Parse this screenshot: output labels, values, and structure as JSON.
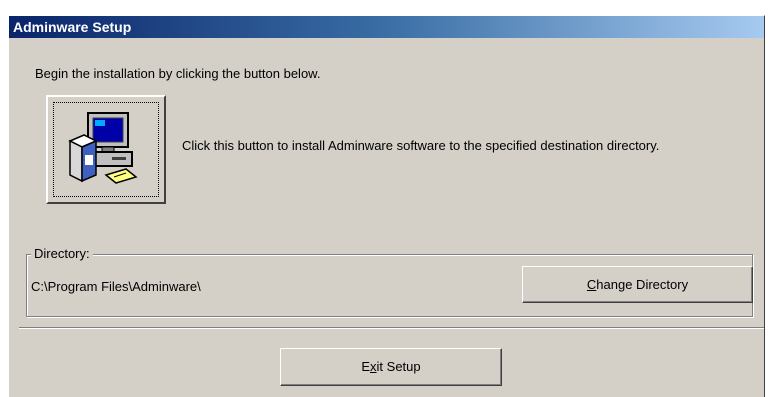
{
  "window": {
    "title": "Adminware Setup"
  },
  "intro_text": "Begin the installation by clicking the button below.",
  "install": {
    "icon": "computer-install-icon",
    "description": "Click this button to install Adminware software to the specified destination directory."
  },
  "directory": {
    "group_label": "Directory:",
    "path": "C:\\Program Files\\Adminware\\",
    "change_button": {
      "prefix": "",
      "mnemonic": "C",
      "suffix": "hange Directory"
    }
  },
  "exit_button": {
    "prefix": "E",
    "mnemonic": "x",
    "suffix": "it Setup"
  },
  "colors": {
    "title_gradient_start": "#0a246a",
    "title_gradient_end": "#a6caf0",
    "face": "#d4d0c8"
  }
}
